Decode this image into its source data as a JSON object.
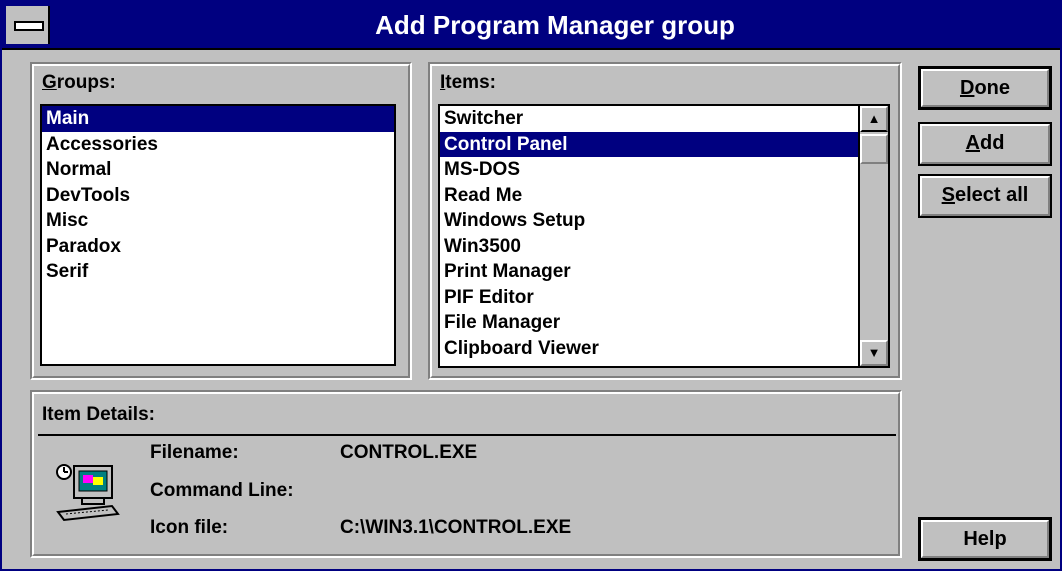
{
  "window": {
    "title": "Add Program Manager group"
  },
  "groups": {
    "label_underline": "G",
    "label_rest": "roups:",
    "items": [
      "Main",
      "Accessories",
      "Normal",
      "DevTools",
      "Misc",
      "Paradox",
      "Serif"
    ],
    "selected": "Main"
  },
  "items": {
    "label_underline": "I",
    "label_rest": "tems:",
    "list": [
      "Switcher",
      "Control Panel",
      "MS-DOS",
      "Read Me",
      "Windows Setup",
      "Win3500",
      "Print Manager",
      "PIF Editor",
      "File Manager",
      "Clipboard Viewer"
    ],
    "selected": "Control Panel"
  },
  "buttons": {
    "done": {
      "underline": "D",
      "rest": "one"
    },
    "add": {
      "underline": "A",
      "rest": "dd"
    },
    "select_all": {
      "underline": "S",
      "rest": "elect all"
    },
    "help": "Help"
  },
  "details": {
    "heading": "Item Details:",
    "filename_label": "Filename:",
    "filename_value": "CONTROL.EXE",
    "command_label": "Command Line:",
    "command_value": "",
    "icon_file_label": "Icon file:",
    "icon_file_value": "C:\\WIN3.1\\CONTROL.EXE",
    "icon": "computer-icon"
  },
  "colors": {
    "title_bar": "#000080",
    "selection": "#000080",
    "face": "#c0c0c0"
  }
}
